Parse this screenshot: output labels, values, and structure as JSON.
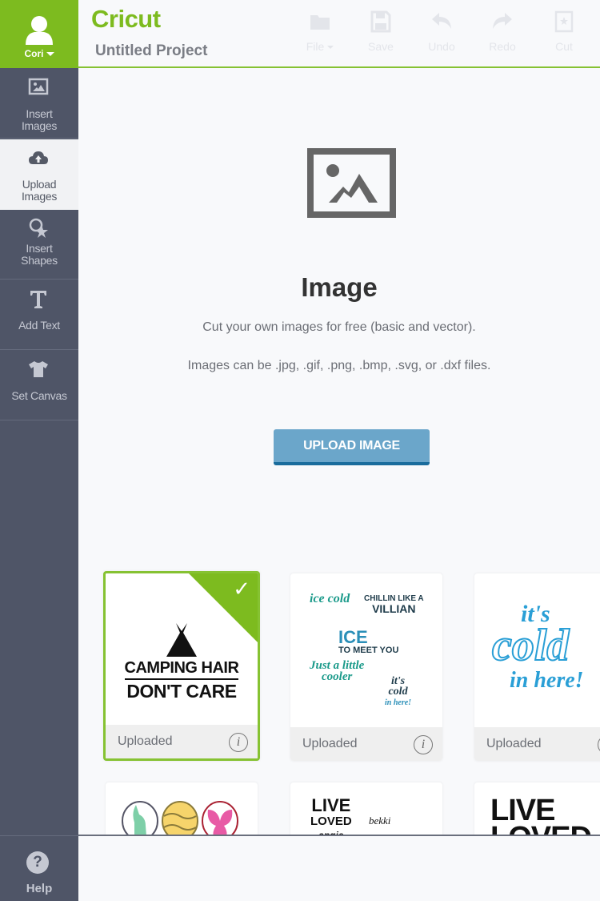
{
  "user": {
    "name": "Cori"
  },
  "header": {
    "logo": "Cricut",
    "project_title": "Untitled Project",
    "tools": [
      {
        "label": "File",
        "icon": "folder-icon",
        "has_dropdown": true
      },
      {
        "label": "Save",
        "icon": "save-icon"
      },
      {
        "label": "Undo",
        "icon": "undo-icon"
      },
      {
        "label": "Redo",
        "icon": "redo-icon"
      },
      {
        "label": "Cut",
        "icon": "cut-icon"
      }
    ]
  },
  "sidebar": {
    "items": [
      {
        "label_line1": "Insert",
        "label_line2": "Images",
        "icon": "image-icon"
      },
      {
        "label_line1": "Upload",
        "label_line2": "Images",
        "icon": "cloud-upload-icon",
        "active": true
      },
      {
        "label_line1": "Insert",
        "label_line2": "Shapes",
        "icon": "shapes-icon"
      },
      {
        "label_line1": "Add Text",
        "icon": "text-icon"
      },
      {
        "label_line1": "Set Canvas",
        "icon": "shirt-icon"
      }
    ],
    "help_label": "Help"
  },
  "main": {
    "title": "Image",
    "description": "Cut your own images for free (basic and vector).",
    "formats": "Images can be .jpg, .gif, .png, .bmp, .svg, or .dxf files.",
    "upload_button": "UPLOAD IMAGE",
    "cards": [
      {
        "status": "Uploaded",
        "selected": true,
        "line1": "CAMPING HAIR",
        "line2": "DON'T CARE"
      },
      {
        "status": "Uploaded",
        "selected": false,
        "texts": [
          "ice cold",
          "CHILLIN LIKE A",
          "VILLIAN",
          "ICE",
          "TO MEET YOU",
          "Just a little",
          "cooler",
          "it's",
          "cold",
          "in here!"
        ]
      },
      {
        "status": "Uploaded",
        "selected": false,
        "texts": [
          "it's",
          "cold",
          "in here!"
        ]
      }
    ],
    "partial_cards": [
      {
        "texts": []
      },
      {
        "texts": [
          "LIVE",
          "LOVED",
          "angie",
          "bekki"
        ]
      },
      {
        "texts": [
          "LIVE",
          "LOVED"
        ]
      }
    ]
  },
  "colors": {
    "brand_green": "#7dbb1f",
    "sidebar_bg": "#4f5567",
    "button_blue": "#6ba6ca",
    "button_border": "#1a6c9c"
  }
}
